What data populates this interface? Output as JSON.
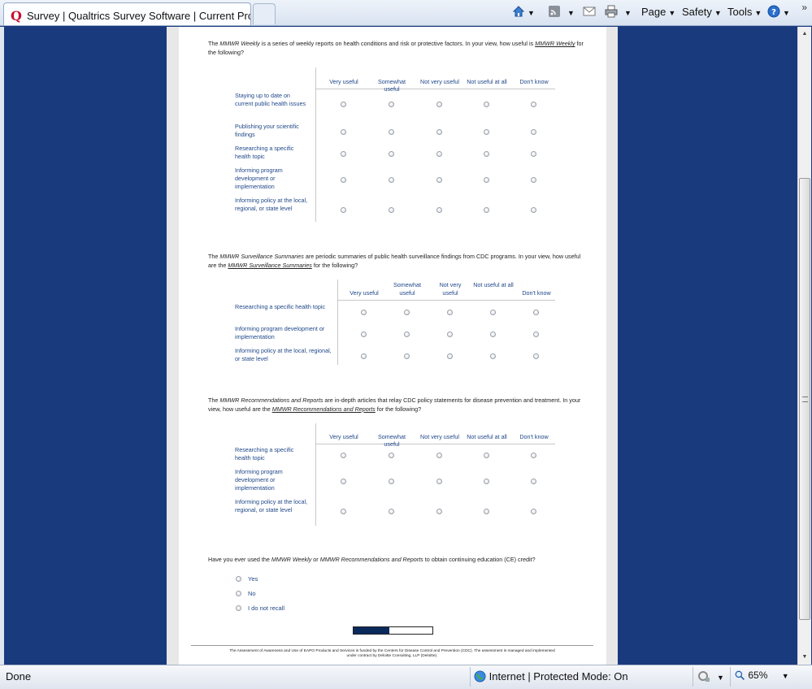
{
  "browser": {
    "tab_title": "Survey | Qualtrics Survey Software | Current Progr...",
    "tab_logo": "Q",
    "commands": {
      "page": "Page",
      "safety": "Safety",
      "tools": "Tools"
    },
    "chevron": "»"
  },
  "questions": {
    "q1": {
      "text_pre": "The ",
      "text_em": "MMWR Weekly",
      "text_mid": " is a series of weekly reports on health conditions and risk or protective factors. In your view, how useful is ",
      "text_link": "MMWR Weekly",
      "text_post": " for the following?",
      "columns": [
        "Very useful",
        "Somewhat useful",
        "Not very useful",
        "Not useful at all",
        "Don't know"
      ],
      "rows": [
        "Staying up to date on current public health issues",
        "Publishing your scientific findings",
        "Researching a specific health topic",
        "Informing program development or implementation",
        "Informing policy at the local, regional, or state level"
      ]
    },
    "q2": {
      "text_pre": "The ",
      "text_em": "MMWR Surveillance Summaries",
      "text_mid": " are periodic summaries of public health surveillance findings from CDC programs. In your view, how useful are the ",
      "text_link": "MMWR Surveillance Summaries",
      "text_post": " for the following?",
      "columns": [
        "Very useful",
        "Somewhat useful",
        "Not very useful",
        "Not useful at all",
        "Don't know"
      ],
      "rows": [
        "Researching a specific health topic",
        "Informing program development or implementation",
        "Informing policy at the local, regional, or state level"
      ]
    },
    "q3": {
      "text_pre": "The ",
      "text_em": "MMWR Recommendations and Reports",
      "text_mid": " are in-depth articles that relay CDC policy statements for disease prevention and treatment. In your view, how useful are the ",
      "text_link": "MMWR Recommendations and Reports",
      "text_post": " for the following?",
      "columns": [
        "Very useful",
        "Somewhat useful",
        "Not very useful",
        "Not useful at all",
        "Don't know"
      ],
      "rows": [
        "Researching a specific health topic",
        "Informing program development or implementation",
        "Informing policy at the local, regional, or state level"
      ]
    },
    "q4": {
      "text_pre": "Have you ever used the ",
      "text_em1": "MMWR Weekly",
      "text_mid": " or ",
      "text_em2": "MMWR Recommendations and Reports",
      "text_post": " to obtain continuing education (CE) credit?",
      "choices": [
        "Yes",
        "No",
        "I do not recall"
      ]
    }
  },
  "progress": {
    "fraction": 0.45
  },
  "footer": "The Assessment of Awareness and Use of EAPO Products and Services is funded by the Centers for Disease Control and Prevention (CDC). The assessment is managed and implemented under contract by Deloitte Consulting, LLP (Deloitte).",
  "status_bar": {
    "left": "Done",
    "zone": "Internet | Protected Mode: On",
    "zoom": "65%"
  },
  "colors": {
    "side_panel": "#1a3a7e",
    "label_blue": "#1f4788",
    "progress_fill": "#0b2a5c"
  },
  "icons": [
    "home-icon",
    "rss-feeds-icon",
    "read-mail-icon",
    "print-icon",
    "help-icon",
    "globe-icon",
    "add-on-icon",
    "zoom-icon"
  ]
}
